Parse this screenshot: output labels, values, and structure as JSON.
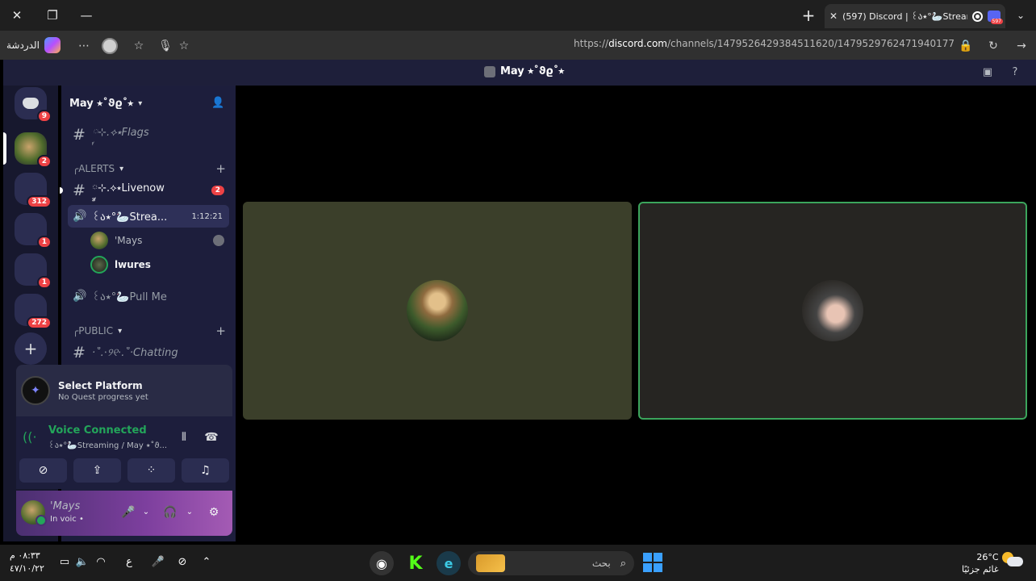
{
  "browser": {
    "tab_title": "(597) Discord | ꒰ა⭑°🦢Streaming",
    "tab_badge": "597",
    "chat_label": "الدردشة",
    "url_prefix": "https://",
    "url_domain": "discord.com",
    "url_path": "/channels/1479526429384511620/1479529762471940177"
  },
  "discord": {
    "window_title": "May ⭑˚ϑϱ˚⭑",
    "servers": [
      {
        "name": "direct-messages",
        "badge": "9"
      },
      {
        "name": "server-1",
        "badge": "2"
      },
      {
        "name": "folder-1",
        "badge": "312"
      },
      {
        "name": "folder-2",
        "badge": "1"
      },
      {
        "name": "server-3",
        "badge": "1"
      },
      {
        "name": "folder-3",
        "badge": "272"
      }
    ],
    "guild_name": "May ⭑˚ϑϱ˚⭑",
    "channels": {
      "flags": "◌࿆⊹.⟡⭑Flags",
      "alerts_category": "╭ALERTS",
      "livenow": "◌࿆⊹.⟡⭑Livenow",
      "livenow_badge": "2",
      "streaming": "꒰ა⭑°🦢Strea...",
      "streaming_time": "1:12:21",
      "pullme": "꒰ა⭑°🦢Pull Me",
      "public_category": "╭PUBLIC",
      "chatting": "·˚.⋅୨୧⋅.˚·Chatting"
    },
    "voice_users": [
      {
        "name": "'Mays"
      },
      {
        "name": "lwures"
      }
    ],
    "quest": {
      "title": "Select Platform",
      "subtitle": "No Quest progress yet"
    },
    "voice_panel": {
      "title": "Voice Connected",
      "subtitle": "꒰ა⭑°🦢Streaming / May ⭑˚ϑ..."
    },
    "user_panel": {
      "name": "'Mays",
      "status": "In voic •"
    }
  },
  "taskbar": {
    "time": "٠٨:٣٣ م",
    "date": "٤٧/١٠/٢٢",
    "lang": "ع",
    "search_placeholder": "بحث",
    "temperature": "26°C",
    "weather_label": "غائم جزئيًا"
  },
  "colors": {
    "accent_green": "#23a55a",
    "mention_red": "#ed4245",
    "sidebar_bg": "#1d1e3c"
  }
}
